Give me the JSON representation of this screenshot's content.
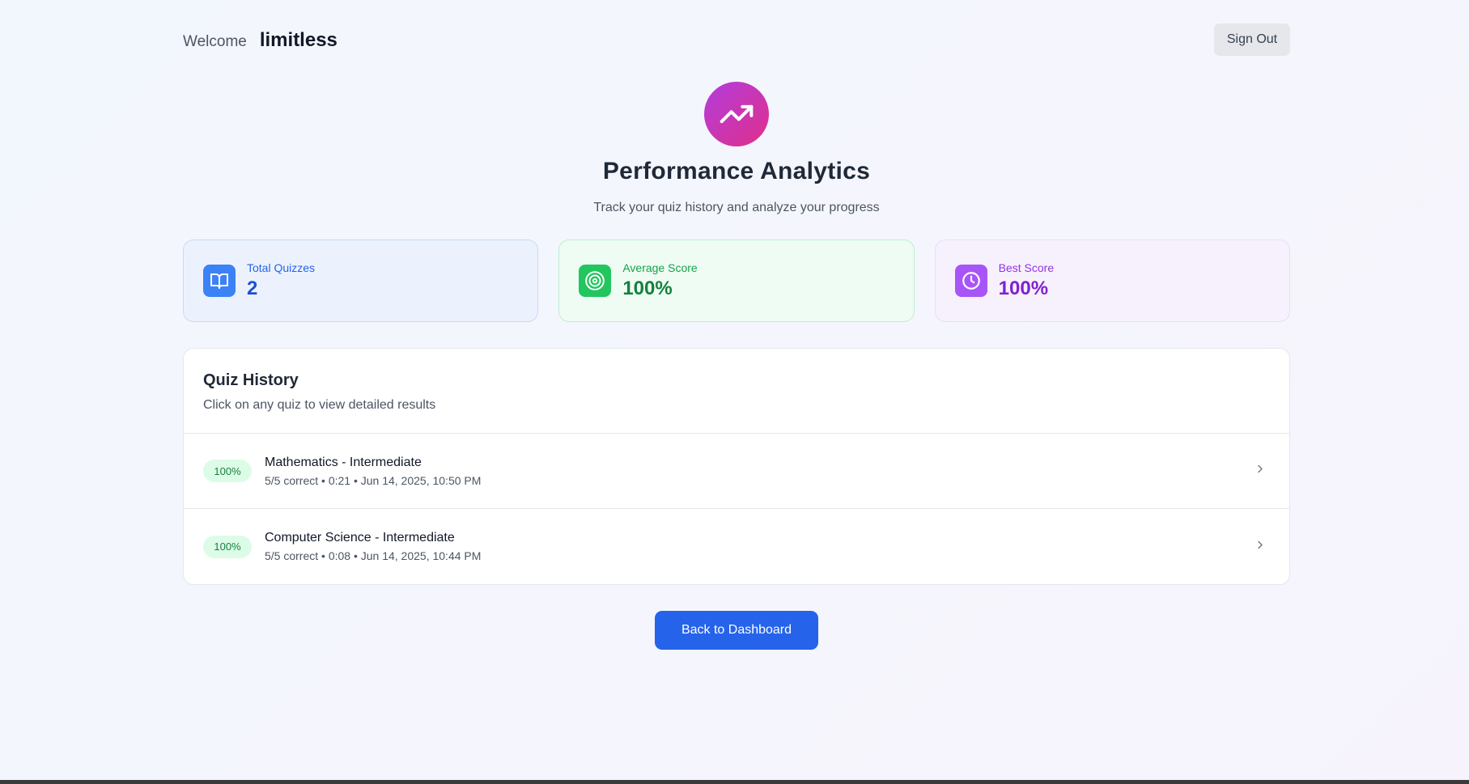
{
  "header": {
    "welcome_label": "Welcome",
    "username": "limitless",
    "signout_label": "Sign Out"
  },
  "hero": {
    "icon": "trending-up-icon",
    "title": "Performance Analytics",
    "subtitle": "Track your quiz history and analyze your progress"
  },
  "stats": [
    {
      "icon": "book-open-icon",
      "label": "Total Quizzes",
      "value": "2",
      "color": "#3b82f6"
    },
    {
      "icon": "target-icon",
      "label": "Average Score",
      "value": "100%",
      "color": "#22c55e"
    },
    {
      "icon": "clock-icon",
      "label": "Best Score",
      "value": "100%",
      "color": "#a855f7"
    }
  ],
  "history": {
    "title": "Quiz History",
    "subtitle": "Click on any quiz to view detailed results",
    "items": [
      {
        "score": "100%",
        "title": "Mathematics - Intermediate",
        "meta": "5/5 correct • 0:21 • Jun 14, 2025, 10:50 PM"
      },
      {
        "score": "100%",
        "title": "Computer Science - Intermediate",
        "meta": "5/5 correct • 0:08 • Jun 14, 2025, 10:44 PM"
      }
    ]
  },
  "actions": {
    "back_label": "Back to Dashboard"
  },
  "colors": {
    "primary": "#2563eb",
    "hero_gradient_start": "#b23ddd",
    "hero_gradient_end": "#e02f8a",
    "badge_bg": "#dcfce7",
    "badge_text": "#15803d"
  }
}
